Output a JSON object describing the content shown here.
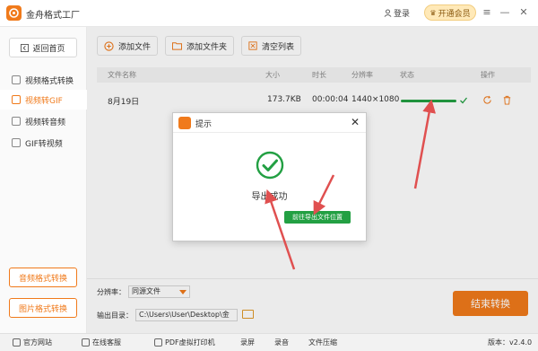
{
  "app": {
    "title": "金舟格式工厂"
  },
  "header": {
    "login": "登录",
    "vip": "开通会员"
  },
  "sidebar": {
    "home": "返回首页",
    "items": [
      {
        "label": "视频格式转换"
      },
      {
        "label": "视频转GIF"
      },
      {
        "label": "视频转音频"
      },
      {
        "label": "GIF转视频"
      }
    ],
    "audio_btn": "音频格式转换",
    "image_btn": "图片格式转换"
  },
  "toolbar": {
    "add_file": "添加文件",
    "add_folder": "添加文件夹",
    "clear_list": "清空列表"
  },
  "table": {
    "headers": {
      "name": "文件名称",
      "size": "大小",
      "duration": "时长",
      "resolution": "分辨率",
      "status": "状态",
      "action": "操作"
    },
    "rows": [
      {
        "name": "8月19日",
        "size": "173.7KB",
        "duration": "00:00:04",
        "resolution": "1440×1080",
        "progress": 1.0
      }
    ]
  },
  "bottom": {
    "resolution_label": "分辨率：",
    "resolution_value": "同源文件",
    "output_label": "输出目录：",
    "output_path": "C:\\Users\\User\\Desktop\\金",
    "start": "结束转换"
  },
  "footer": {
    "website": "官方网站",
    "service": "在线客服",
    "pdf": "PDF虚拟打印机",
    "record": "录屏",
    "audio": "录音",
    "compress": "文件压缩",
    "version": "版本：v2.4.0"
  },
  "dialog": {
    "title": "提示",
    "message": "导出成功",
    "button": "前往导出文件位置"
  },
  "colors": {
    "accent": "#f07a1b",
    "success": "#23a043",
    "arrow": "#e05050"
  }
}
